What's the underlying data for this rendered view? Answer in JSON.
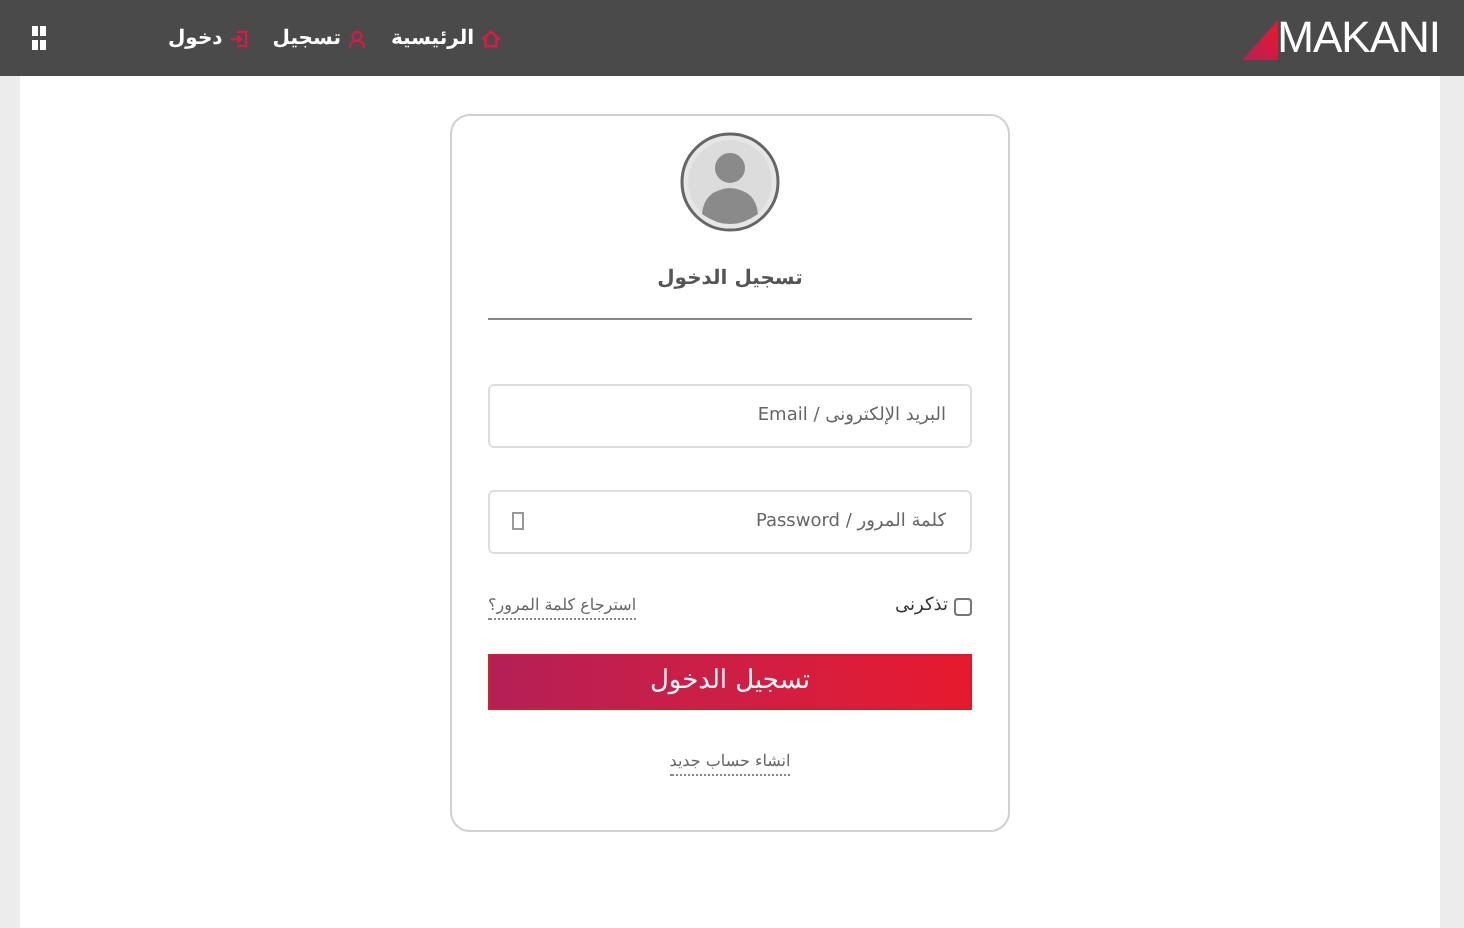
{
  "header": {
    "logo": "MAKANI",
    "nav": [
      {
        "label": "الرئيسية",
        "kind": "home"
      },
      {
        "label": "تسجيل",
        "kind": "user"
      },
      {
        "label": "دخول",
        "kind": "login"
      }
    ]
  },
  "login": {
    "title": "تسجيل الدخول",
    "email": {
      "placeholder": "البريد الإلكترونى / Email"
    },
    "password": {
      "placeholder": "كلمة المرور / Password"
    },
    "remember": {
      "label": "تذكرنى",
      "checked": false
    },
    "forgot": "استرجاع كلمة المرور؟",
    "submit": "تسجيل الدخول",
    "register": "انشاء حساب جديد"
  }
}
